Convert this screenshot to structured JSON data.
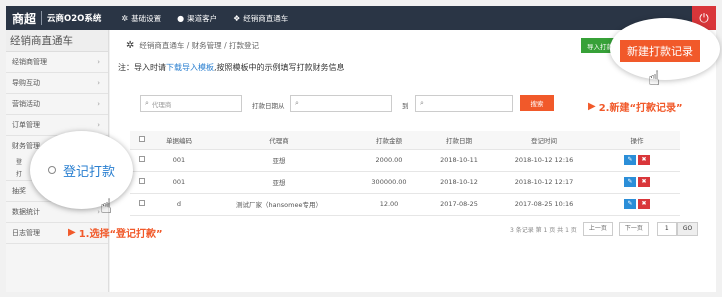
{
  "topbar": {
    "logo": "商超",
    "system_name": "云商O2O系统",
    "nav": [
      {
        "icon": "gear-icon",
        "label": "基础设置"
      },
      {
        "icon": "user-icon",
        "label": "渠道客户"
      },
      {
        "icon": "users-icon",
        "label": "经销商直通车"
      }
    ]
  },
  "sidebar": {
    "title": "经销商直通车",
    "items": [
      {
        "label": "经销商管理"
      },
      {
        "label": "导购互动"
      },
      {
        "label": "营销活动"
      },
      {
        "label": "订单管理"
      },
      {
        "label": "财务管理"
      },
      {
        "label": "抽奖"
      },
      {
        "label": "数据统计"
      },
      {
        "label": "日志管理"
      }
    ],
    "sub_items": [
      "登",
      "打"
    ]
  },
  "breadcrumb": [
    "经销商直通车",
    "财务管理",
    "打款登记"
  ],
  "import_button": "导入打款",
  "new_button": "新建打款记录",
  "note": {
    "prefix": "注：导入时请",
    "link": "下载导入模板",
    "suffix": ",按照模板中的示例填写打款财务信息"
  },
  "filters": {
    "agent_placeholder": "代理商",
    "date_label": "打款日期从",
    "to_label": "到",
    "search_button": "搜索"
  },
  "table": {
    "headers": [
      "单据编码",
      "代理商",
      "打款金额",
      "打款日期",
      "登记时间",
      "操作"
    ],
    "rows": [
      {
        "code": "001",
        "agent": "亚想",
        "amount": "2000.00",
        "date": "2018-10-11",
        "registered": "2018-10-12 12:16"
      },
      {
        "code": "001",
        "agent": "亚想",
        "amount": "300000.00",
        "date": "2018-10-12",
        "registered": "2018-10-12 12:17"
      },
      {
        "code": "d",
        "agent": "测试厂家（hansomee专用）",
        "amount": "12.00",
        "date": "2017-08-25",
        "registered": "2017-08-25 10:16"
      }
    ]
  },
  "pager": {
    "summary": "3 条记录 第 1 页 共 1 页",
    "prev": "上一页",
    "next": "下一页",
    "page": "1",
    "go": "GO"
  },
  "callouts": {
    "zoom_label": "登记打款",
    "step1": "1.选择“登记打款”",
    "step2": "2.新建“打款记录”"
  },
  "colors": {
    "topbar": "#2a3545",
    "accent_orange": "#f1592a",
    "import_green": "#37a138",
    "link_blue": "#2a7fd0"
  }
}
